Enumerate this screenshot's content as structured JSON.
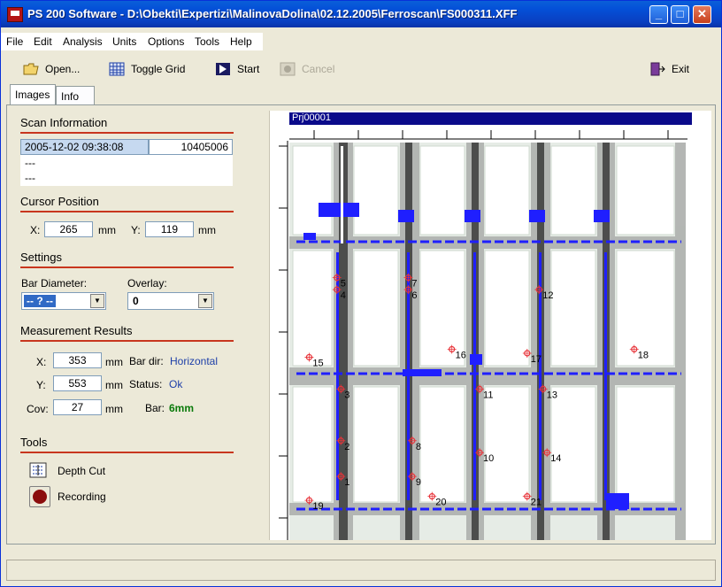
{
  "window": {
    "title": "PS 200 Software - D:\\Obekti\\Expertizi\\MalinovaDolina\\02.12.2005\\Ferroscan\\FS000311.XFF",
    "minimize": "_",
    "maximize": "□",
    "close": "✕"
  },
  "menu": [
    "File",
    "Edit",
    "Analysis",
    "Units",
    "Options",
    "Tools",
    "Help"
  ],
  "toolbar": {
    "open": "Open...",
    "toggle_grid": "Toggle Grid",
    "start": "Start",
    "cancel": "Cancel",
    "exit": "Exit"
  },
  "tabs": [
    "Images",
    "Info"
  ],
  "scan_info": {
    "title": "Scan Information",
    "datetime": "2005-12-02 09:38:08",
    "id": "10405006",
    "line2": "---",
    "line3": "---"
  },
  "cursor": {
    "title": "Cursor Position",
    "x_label": "X:",
    "x_value": "265",
    "x_unit": "mm",
    "y_label": "Y:",
    "y_value": "119",
    "y_unit": "mm"
  },
  "settings": {
    "title": "Settings",
    "bar_diameter_label": "Bar Diameter:",
    "bar_diameter_value": "-- ? --",
    "overlay_label": "Overlay:",
    "overlay_value": "0"
  },
  "results": {
    "title": "Measurement Results",
    "x_label": "X:",
    "x_value": "353",
    "y_label": "Y:",
    "y_value": "553",
    "cov_label": "Cov:",
    "cov_value": "27",
    "unit": "mm",
    "bar_dir_label": "Bar dir:",
    "bar_dir_value": "Horizontal",
    "status_label": "Status:",
    "status_value": "Ok",
    "bar_label": "Bar:",
    "bar_value": "6mm"
  },
  "tools": {
    "title": "Tools",
    "depth_cut": "Depth Cut",
    "recording": "Recording"
  },
  "scan": {
    "name": "Prj00001",
    "markers": [
      {
        "n": "1",
        "x": 0.13,
        "y": 0.84
      },
      {
        "n": "2",
        "x": 0.13,
        "y": 0.75
      },
      {
        "n": "3",
        "x": 0.13,
        "y": 0.62
      },
      {
        "n": "4",
        "x": 0.12,
        "y": 0.37
      },
      {
        "n": "5",
        "x": 0.12,
        "y": 0.34
      },
      {
        "n": "6",
        "x": 0.3,
        "y": 0.37
      },
      {
        "n": "7",
        "x": 0.3,
        "y": 0.34
      },
      {
        "n": "8",
        "x": 0.31,
        "y": 0.75
      },
      {
        "n": "9",
        "x": 0.31,
        "y": 0.84
      },
      {
        "n": "10",
        "x": 0.48,
        "y": 0.78
      },
      {
        "n": "11",
        "x": 0.48,
        "y": 0.62
      },
      {
        "n": "12",
        "x": 0.63,
        "y": 0.37
      },
      {
        "n": "13",
        "x": 0.64,
        "y": 0.62
      },
      {
        "n": "14",
        "x": 0.65,
        "y": 0.78
      },
      {
        "n": "15",
        "x": 0.05,
        "y": 0.54
      },
      {
        "n": "16",
        "x": 0.41,
        "y": 0.52
      },
      {
        "n": "17",
        "x": 0.6,
        "y": 0.53
      },
      {
        "n": "18",
        "x": 0.87,
        "y": 0.52
      },
      {
        "n": "19",
        "x": 0.05,
        "y": 0.9
      },
      {
        "n": "20",
        "x": 0.36,
        "y": 0.89
      },
      {
        "n": "21",
        "x": 0.6,
        "y": 0.89
      }
    ]
  },
  "colors": {
    "accent_red": "#c8361e",
    "scan_blue": "#1f1fff",
    "header_navy": "#0a0a8a"
  }
}
